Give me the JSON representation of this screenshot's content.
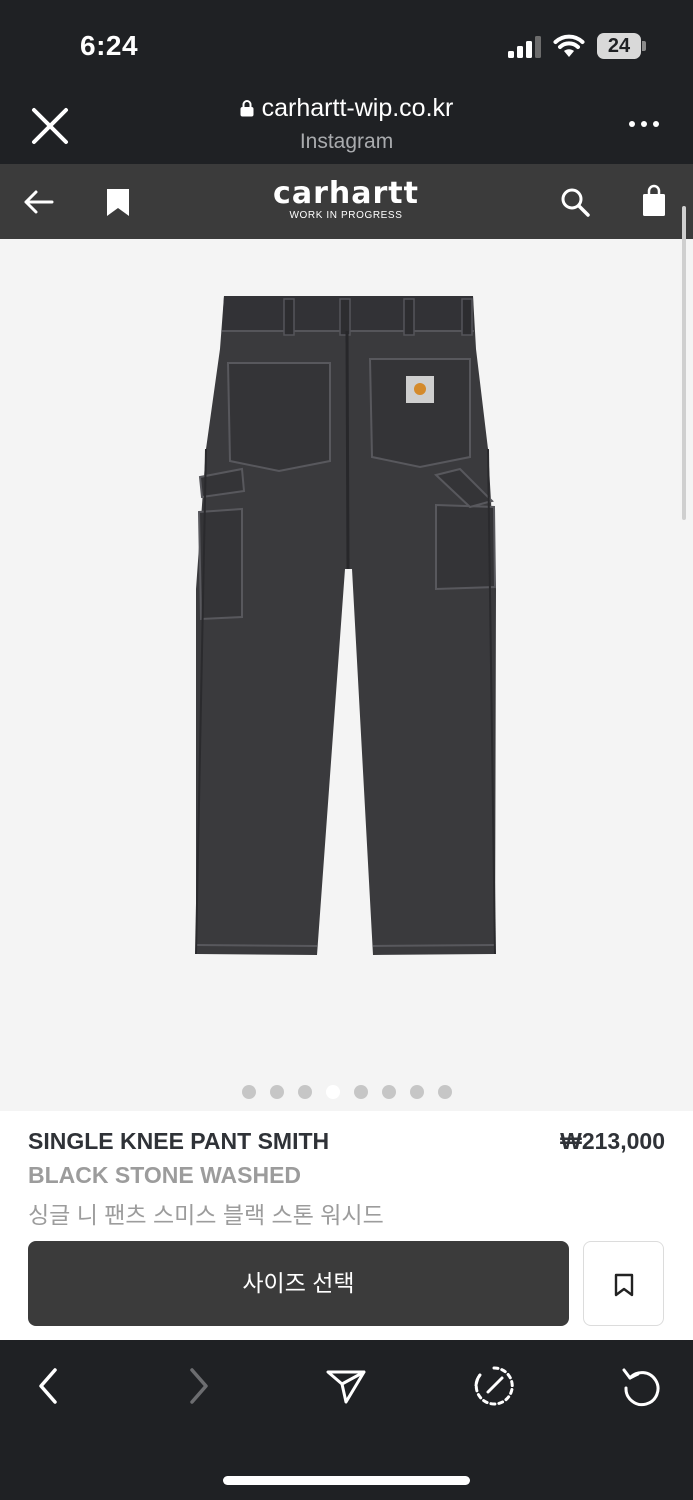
{
  "status_bar": {
    "time": "6:24",
    "battery": "24"
  },
  "browser": {
    "url": "carhartt-wip.co.kr",
    "source": "Instagram"
  },
  "site_header": {
    "logo_main": "carhartt",
    "logo_sub": "WORK IN PROGRESS"
  },
  "gallery": {
    "dot_count": 8,
    "active_index": 3
  },
  "product": {
    "name": "SINGLE KNEE PANT SMITH",
    "price": "₩213,000",
    "color": "BLACK STONE WASHED",
    "name_kr": "싱글 니 팬츠 스미스 블랙 스톤 워시드",
    "size_button": "사이즈 선택"
  }
}
